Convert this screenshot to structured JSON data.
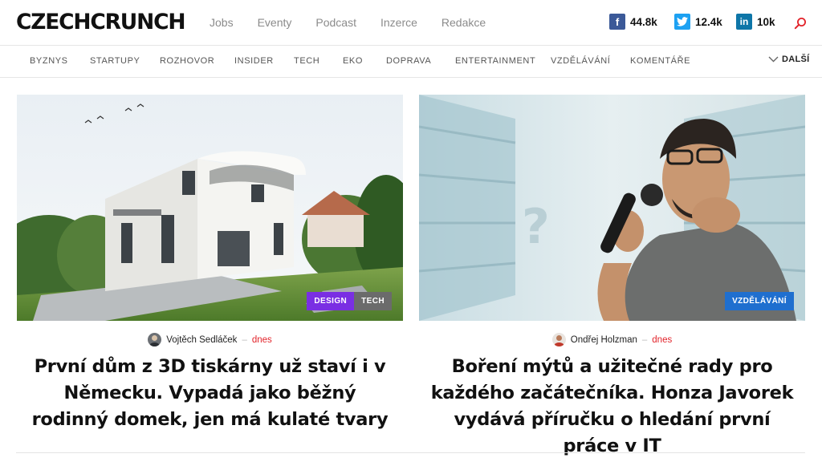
{
  "brand": {
    "logo": "CZECHCRUNCH"
  },
  "main_nav": [
    "Jobs",
    "Eventy",
    "Podcast",
    "Inzerce",
    "Redakce"
  ],
  "social": [
    {
      "icon": "facebook-icon",
      "glyph": "f",
      "count": "44.8k",
      "color": "#3b5998"
    },
    {
      "icon": "twitter-icon",
      "glyph": "t",
      "count": "12.4k",
      "color": "#1da1f2"
    },
    {
      "icon": "linkedin-icon",
      "glyph": "in",
      "count": "10k",
      "color": "#0e76a8"
    }
  ],
  "categories": [
    "BYZNYS",
    "STARTUPY",
    "ROZHOVOR",
    "INSIDER",
    "TECH",
    "EKO",
    "DOPRAVA",
    "ENTERTAINMENT",
    "VZDĚLÁVÁNÍ",
    "KOMENTÁŘE"
  ],
  "more_label": "DALŠÍ",
  "accent_color": "#e2232a",
  "articles": [
    {
      "tags": [
        {
          "label": "DESIGN",
          "color": "#7a2fe3"
        },
        {
          "label": "TECH",
          "color": "#6b6b6b"
        }
      ],
      "author": "Vojtěch Sedláček",
      "separator": "–",
      "time": "dnes",
      "title": "První dům z 3D tiskárny už staví i v Německu. Vypadá jako běžný rodinný domek, jen má kulaté tvary"
    },
    {
      "tags": [
        {
          "label": "VZDĚLÁVÁNÍ",
          "color": "#1f6fcf"
        }
      ],
      "author": "Ondřej Holzman",
      "separator": "–",
      "time": "dnes",
      "title": "Boření mýtů a užitečné rady pro každého začátečníka. Honza Javorek vydává příručku o hledání první práce v IT"
    }
  ]
}
